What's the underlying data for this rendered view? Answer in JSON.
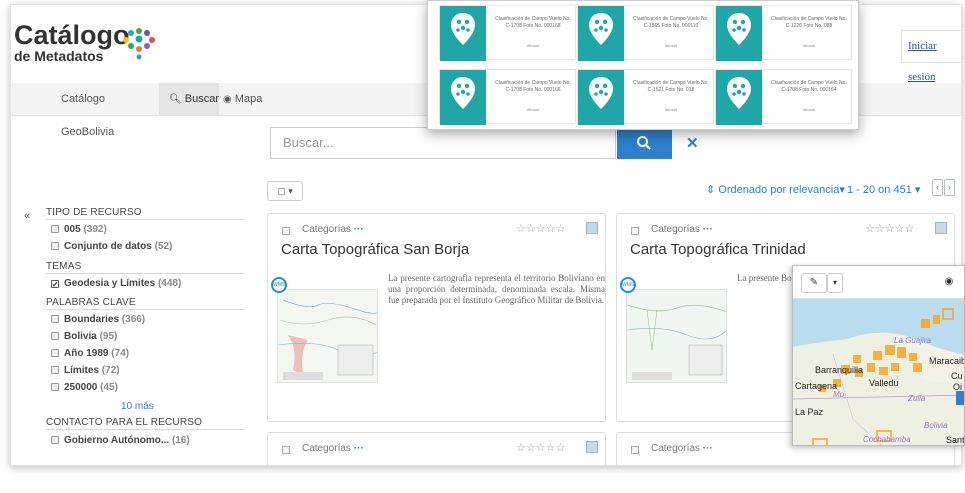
{
  "header": {
    "logo_title": "Catálogo",
    "logo_subtitle": "de Metadatos",
    "login_label": "Iniciar sesión"
  },
  "nav": {
    "items": [
      {
        "label": "Catálogo GeoBolivia"
      },
      {
        "label": "Buscar"
      },
      {
        "label": "Mapa"
      }
    ]
  },
  "search": {
    "placeholder": "Buscar...",
    "clear_icon": "✕"
  },
  "toolbar": {
    "select_label": "▢ ▾",
    "sort_label": "⇕ Ordenado por relevancia▾",
    "pagination": "1 - 20 on 451 ▾",
    "prev": "‹",
    "next": "›"
  },
  "sidebar": {
    "collapse": "«",
    "facets": [
      {
        "heading": "TIPO DE RECURSO",
        "items": [
          {
            "label": "005",
            "count": "(392)",
            "checked": false
          },
          {
            "label": "Conjunto de datos",
            "count": "(52)",
            "checked": false
          }
        ]
      },
      {
        "heading": "TEMAS",
        "items": [
          {
            "label": "Geodesia y Límites",
            "count": "(448)",
            "checked": true
          }
        ]
      },
      {
        "heading": "PALABRAS CLAVE",
        "items": [
          {
            "label": "Boundaries",
            "count": "(366)",
            "checked": false
          },
          {
            "label": "Bolivia",
            "count": "(95)",
            "checked": false
          },
          {
            "label": "Año 1989",
            "count": "(74)",
            "checked": false
          },
          {
            "label": "Límites",
            "count": "(72)",
            "checked": false
          },
          {
            "label": "250000",
            "count": "(45)",
            "checked": false
          }
        ]
      },
      {
        "heading": "CONTACTO PARA EL RECURSO",
        "items": [
          {
            "label": "Gobierno Autónomo...",
            "count": "(16)",
            "checked": false
          }
        ]
      }
    ],
    "more": "10 más"
  },
  "cards": [
    {
      "category": "Categorías",
      "dots": "···",
      "title": "Carta Topográfica San Borja",
      "stars": "☆☆☆☆☆",
      "badge": "WMS",
      "description": "La presente cartografía representa el territorio Boliviano en una proporción determinada, denominada escala. Misma fue preparada por el Instituto Geográfico Militar de Bolivia."
    },
    {
      "category": "Categorías",
      "dots": "···",
      "title": "Carta Topográfica Trinidad",
      "stars": "☆☆☆☆☆",
      "badge": "WMS",
      "description": "La presente Boliviano en denominada e Instituto Geo"
    },
    {
      "category": "Categorías",
      "dots": "···",
      "stars": "☆☆☆☆☆"
    },
    {
      "category": "Categorías",
      "dots": "···"
    }
  ],
  "popover": {
    "tiles": [
      {
        "title": "Clasificación de Campo Vuelo No. C-1708 Foto No. 000168",
        "label": "Almost"
      },
      {
        "title": "Clasificación de Campo Vuelo No. C-1865 Foto No. 000110",
        "label": "Almost"
      },
      {
        "title": "Clasificación de Campo Vuelo No. C-1226 Foto No. 088",
        "label": "Almost"
      },
      {
        "title": "Clasificación de Campo Vuelo No. C-1708 Foto No. 000166",
        "label": "Almost"
      },
      {
        "title": "Clasificación de Campo Vuelo No. C-1521 Foto No. 018",
        "label": "Almost"
      },
      {
        "title": "Clasificación de Campo Vuelo No. C-1708 Foto No. 000164",
        "label": "Almost"
      }
    ]
  },
  "overlay_map": {
    "labels": {
      "barranquilla": "Barranquilla",
      "cartagena": "Cartagena",
      "la_guajira": "La Guajira",
      "maracaibo": "Maracaibo",
      "zulia": "Zulia",
      "la_paz": "La Paz",
      "bolivia": "Bolivia",
      "cochabamba": "Cochabamba",
      "santa": "Sant",
      "valledupar": "Valledu",
      "mo": "Mo",
      "cu": "Cu",
      "oi": "Oi"
    }
  },
  "colors": {
    "accent": "#2e80cc",
    "link": "#2a7ec8",
    "teal": "#1fa7a7",
    "orange": "#f5a623"
  }
}
